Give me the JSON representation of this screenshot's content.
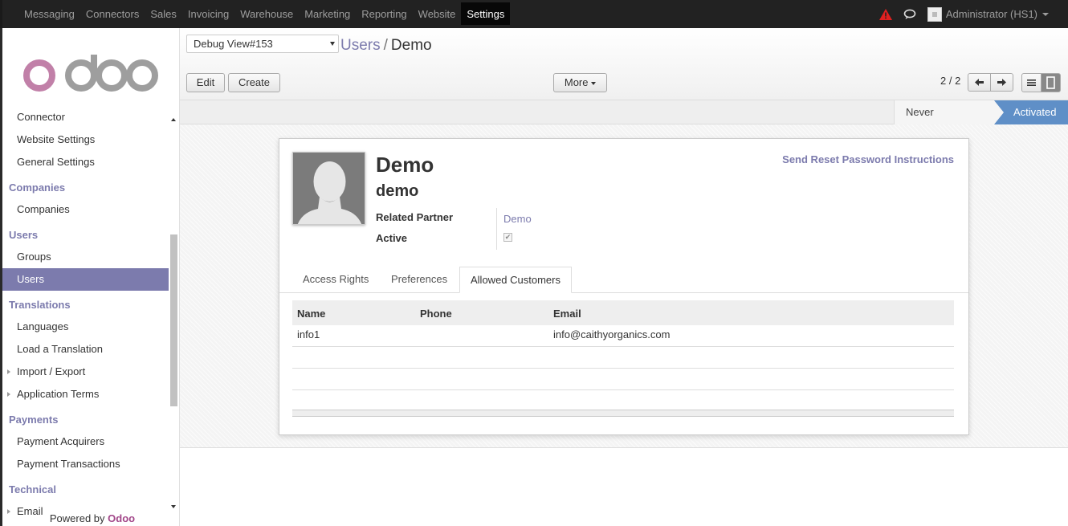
{
  "topbar": {
    "menu": [
      "Messaging",
      "Connectors",
      "Sales",
      "Invoicing",
      "Warehouse",
      "Marketing",
      "Reporting",
      "Website",
      "Settings"
    ],
    "active_menu": "Settings",
    "user": "Administrator (HS1)"
  },
  "sidebar": {
    "groups": [
      {
        "items": [
          "Connector",
          "Website Settings",
          "General Settings"
        ]
      },
      {
        "heading": "Companies",
        "items": [
          "Companies"
        ]
      },
      {
        "heading": "Users",
        "items": [
          "Groups",
          "Users"
        ]
      },
      {
        "heading": "Translations",
        "items": [
          "Languages",
          "Load a Translation",
          "Import / Export",
          "Application Terms"
        ]
      },
      {
        "heading": "Payments",
        "items": [
          "Payment Acquirers",
          "Payment Transactions"
        ]
      },
      {
        "heading": "Technical",
        "items": [
          "Email"
        ]
      }
    ],
    "active_item": "Users",
    "powered_by": "Powered by",
    "powered_brand": "Odoo"
  },
  "control": {
    "debug_select": "Debug View#153",
    "breadcrumb_parent": "Users",
    "breadcrumb_sep": "/",
    "breadcrumb_current": "Demo",
    "edit_label": "Edit",
    "create_label": "Create",
    "more_label": "More",
    "pager": "2 / 2"
  },
  "status": {
    "stages": [
      "Never Connected",
      "Activated"
    ],
    "current": "Activated"
  },
  "form": {
    "name": "Demo",
    "login": "demo",
    "reset_link": "Send Reset Password Instructions",
    "related_partner_label": "Related Partner",
    "related_partner_value": "Demo",
    "active_label": "Active",
    "active_checked": true,
    "tabs": [
      "Access Rights",
      "Preferences",
      "Allowed Customers"
    ],
    "active_tab": "Allowed Customers",
    "grid": {
      "columns": [
        "Name",
        "Phone",
        "Email"
      ],
      "rows": [
        {
          "name": "info1",
          "phone": "",
          "email": "info@caithyorganics.com"
        }
      ]
    }
  }
}
